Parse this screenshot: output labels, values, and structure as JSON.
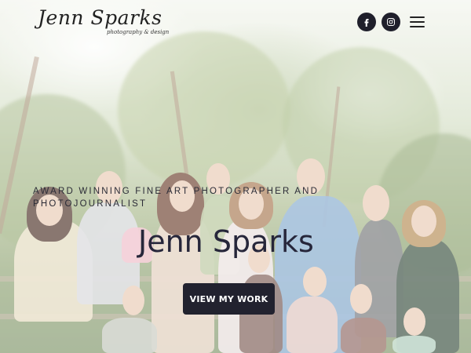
{
  "site": {
    "logo_name": "Jenn Sparks",
    "logo_tagline": "photography & design"
  },
  "header": {
    "social": [
      {
        "name": "facebook",
        "icon": "facebook-icon"
      },
      {
        "name": "instagram",
        "icon": "instagram-icon"
      }
    ],
    "menu_icon": "hamburger-menu-icon"
  },
  "hero": {
    "tagline": "AWARD WINNING FINE ART PHOTOGRAPHER AND PHOTOJOURNALIST",
    "headline": "Jenn Sparks",
    "cta_label": "VIEW MY WORK"
  },
  "colors": {
    "button_bg": "#22222f",
    "icon_bg": "#1f1f2b",
    "text_dark": "#26263a"
  }
}
